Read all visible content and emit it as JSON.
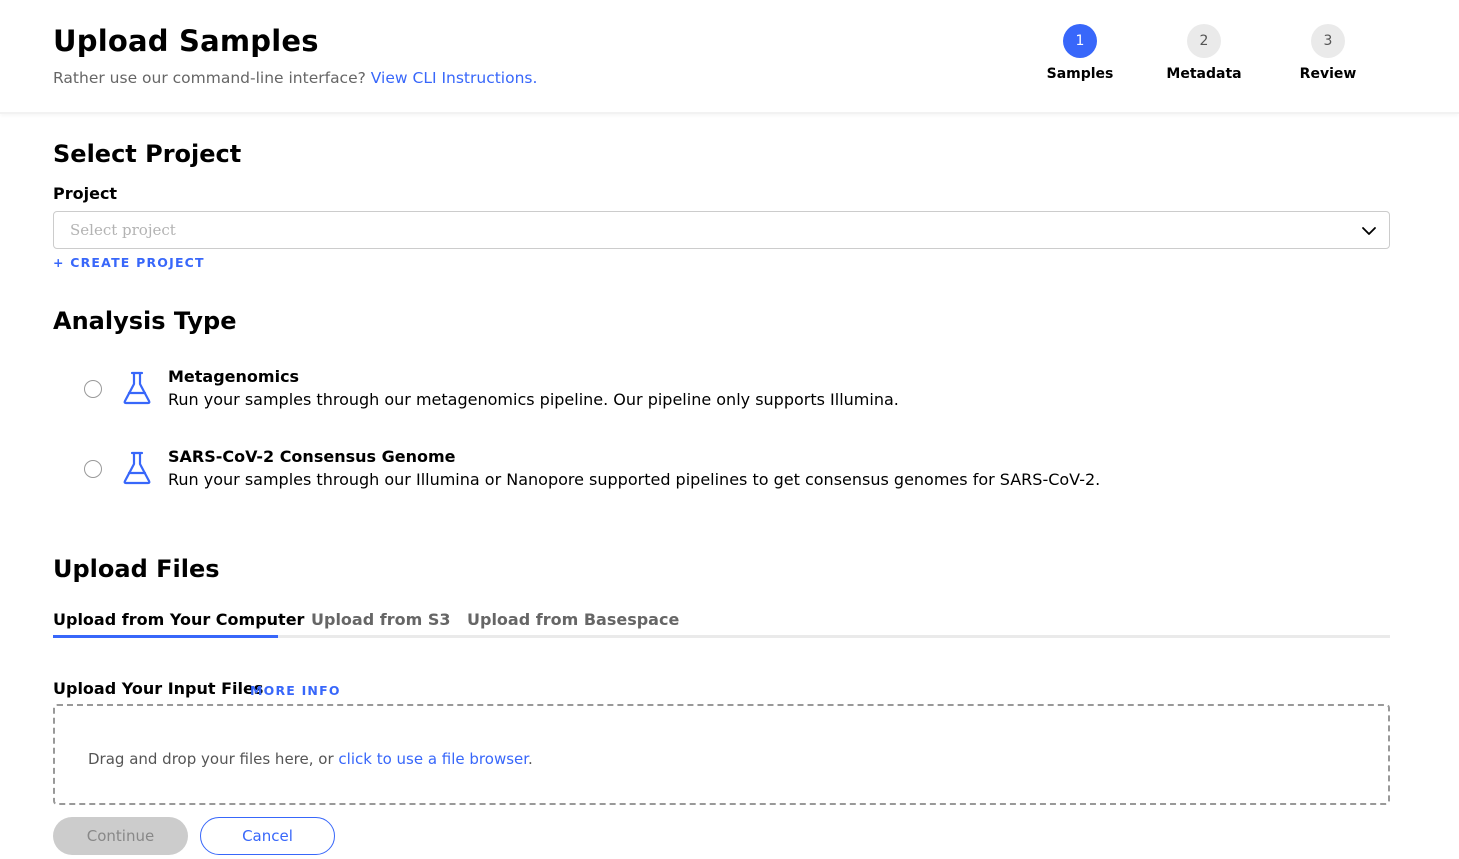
{
  "header": {
    "title": "Upload Samples",
    "subtitle_text": "Rather use our command-line interface?",
    "cli_link": "View CLI Instructions."
  },
  "stepper": [
    {
      "number": "1",
      "label": "Samples",
      "active": true
    },
    {
      "number": "2",
      "label": "Metadata",
      "active": false
    },
    {
      "number": "3",
      "label": "Review",
      "active": false
    }
  ],
  "project": {
    "section_title": "Select Project",
    "field_label": "Project",
    "placeholder": "Select project",
    "create_link": "+ CREATE PROJECT"
  },
  "analysis": {
    "section_title": "Analysis Type",
    "options": [
      {
        "title": "Metagenomics",
        "description": "Run your samples through our metagenomics pipeline. Our pipeline only supports Illumina.",
        "icon": "flask-icon"
      },
      {
        "title": "SARS-CoV-2 Consensus Genome",
        "description": "Run your samples through our Illumina or Nanopore supported pipelines to get consensus genomes for SARS-CoV-2.",
        "icon": "flask-icon"
      }
    ]
  },
  "upload": {
    "section_title": "Upload Files",
    "tabs": [
      {
        "label": "Upload from Your Computer",
        "active": true
      },
      {
        "label": "Upload from S3",
        "active": false
      },
      {
        "label": "Upload from Basespace",
        "active": false
      }
    ],
    "input_label": "Upload Your Input Files",
    "more_info": "MORE INFO",
    "drop_text": "Drag and drop your files here, or",
    "browser_link": "click to use a file browser",
    "drop_suffix": "."
  },
  "actions": {
    "continue_label": "Continue",
    "cancel_label": "Cancel"
  },
  "colors": {
    "accent": "#3867fa",
    "disabled_button": "#cccccc"
  }
}
